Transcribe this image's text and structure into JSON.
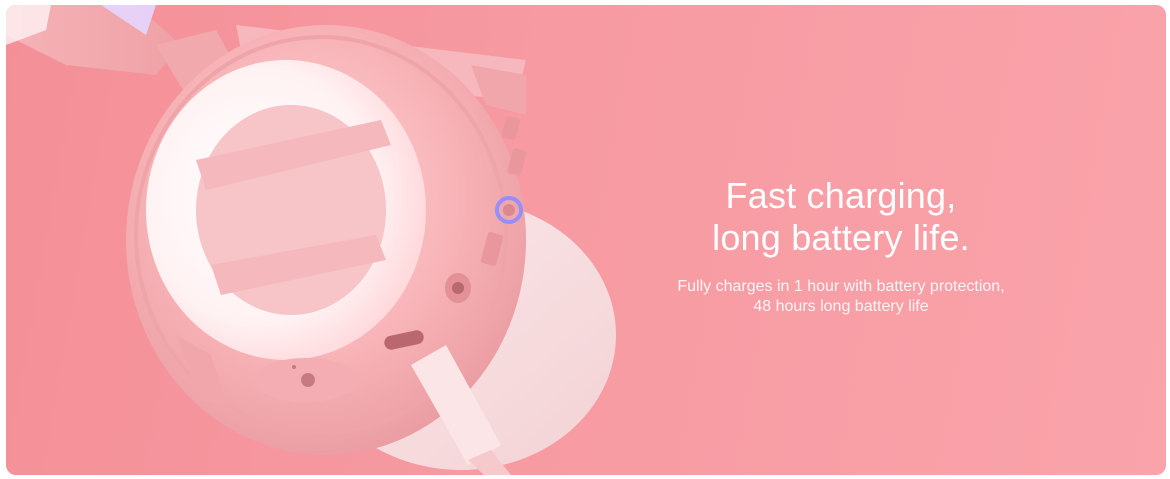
{
  "banner": {
    "headline_line1": "Fast charging,",
    "headline_line2": "long battery life.",
    "subtext_line1": "Fully charges in 1 hour with battery protection,",
    "subtext_line2": "48 hours long battery life",
    "background_color": "#f79aa2",
    "text_color": "#ffffff",
    "accent_glow_color": "#8f8cff"
  },
  "image": {
    "subject": "pink-headphone-earcup-icon"
  }
}
